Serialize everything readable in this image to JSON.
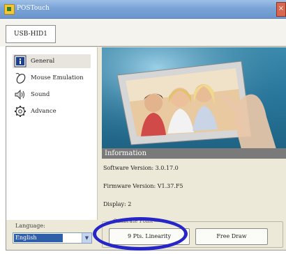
{
  "window": {
    "title": "POSTouch"
  },
  "tabs": [
    {
      "label": "USB-HID1"
    }
  ],
  "sidebar": {
    "items": [
      {
        "label": "General",
        "icon": "info-icon",
        "selected": true
      },
      {
        "label": "Mouse Emulation",
        "icon": "mouse-icon",
        "selected": false
      },
      {
        "label": "Sound",
        "icon": "speaker-icon",
        "selected": false
      },
      {
        "label": "Advance",
        "icon": "gear-icon",
        "selected": false
      }
    ]
  },
  "information": {
    "header": "Information",
    "software_version": "Software Version: 3.0.17.0",
    "firmware_version": "Firmware Version: V1.37.F5",
    "display": "Display: 2"
  },
  "language": {
    "label": "Language:",
    "value": "English"
  },
  "calibration": {
    "group_title": "Calibrate Point",
    "linearity_button": "9 Pts. Linearity",
    "free_draw_button": "Free Draw"
  },
  "colors": {
    "titlebar": "#7aa3d6",
    "info_header": "#7a7a7a",
    "highlight_ellipse": "#2525c8",
    "selected_language": "#2f5fa8"
  }
}
